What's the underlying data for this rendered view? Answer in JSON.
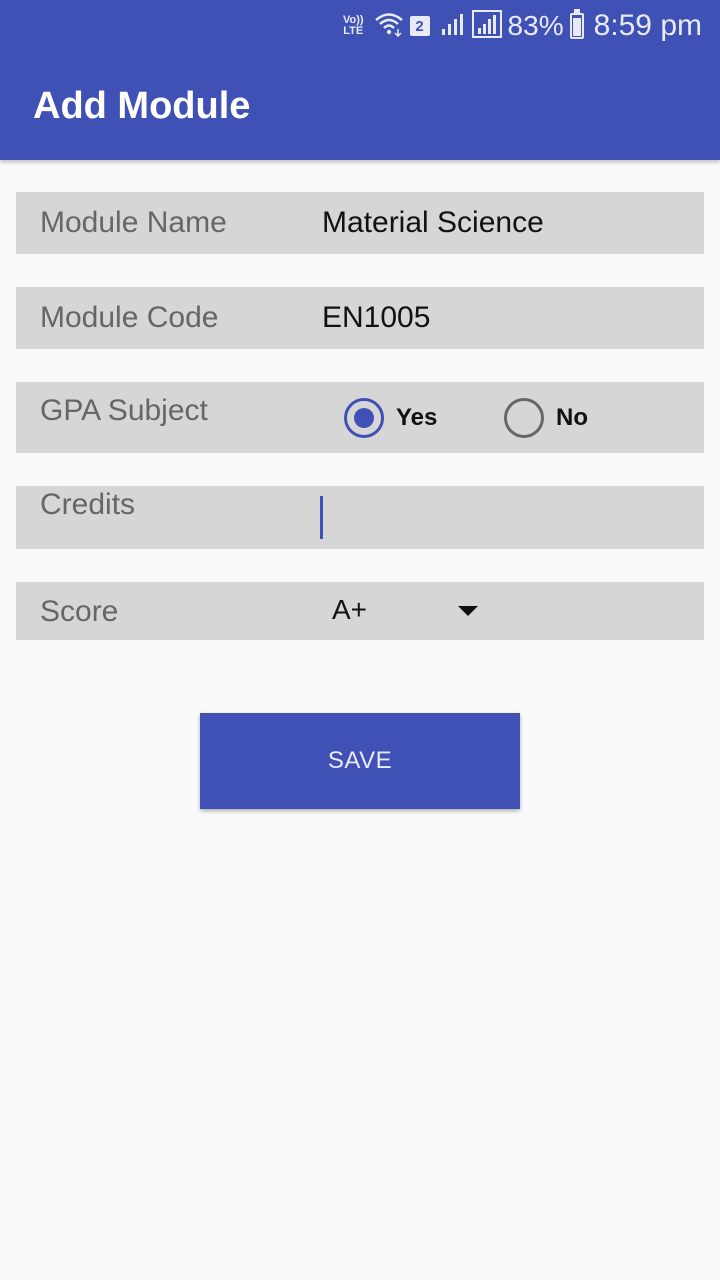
{
  "status_bar": {
    "volte_top": "Vo))",
    "volte_bottom": "LTE",
    "sim_number": "2",
    "battery": "83%",
    "battery_level": 0.83,
    "time": "8:59 pm"
  },
  "app_bar": {
    "title": "Add Module"
  },
  "form": {
    "module_name": {
      "label": "Module Name",
      "value": "Material Science"
    },
    "module_code": {
      "label": "Module Code",
      "value": "EN1005"
    },
    "gpa_subject": {
      "label": "GPA Subject",
      "options": [
        {
          "label": "Yes",
          "checked": true
        },
        {
          "label": "No",
          "checked": false
        }
      ]
    },
    "credits": {
      "label": "Credits",
      "value": ""
    },
    "score": {
      "label": "Score",
      "selected": "A+"
    }
  },
  "actions": {
    "save_label": "SAVE"
  },
  "colors": {
    "primary": "#3f51b5",
    "row_background": "#d6d6d6",
    "page_background": "#fafafa"
  }
}
